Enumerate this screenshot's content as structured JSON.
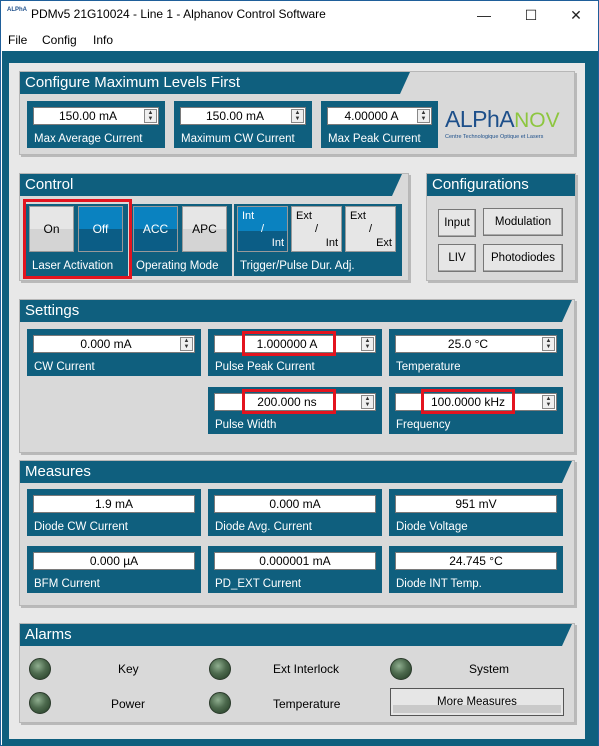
{
  "window": {
    "title": "PDMv5 21G10024 - Line 1 - Alphanov Control Software",
    "app_icon_text": "ALPhA",
    "minimize": "—",
    "maximize": "☐",
    "close": "✕"
  },
  "menu": {
    "items": [
      "File",
      "Config",
      "Info"
    ]
  },
  "configure": {
    "title": "Configure Maximum Levels First",
    "fields": [
      {
        "value": "150.00 mA",
        "label": "Max Average Current"
      },
      {
        "value": "150.00 mA",
        "label": "Maximum CW Current"
      },
      {
        "value": "4.00000 A",
        "label": "Max Peak Current"
      }
    ],
    "logo": {
      "part1": "ALPhA",
      "part2": "NOV",
      "tagline": "Centre Technologique Optique et Lasers",
      "color1": "#1d4f8a",
      "color2": "#8dc63f"
    }
  },
  "control": {
    "title": "Control",
    "laser": {
      "on": "On",
      "off": "Off",
      "label": "Laser Activation",
      "selected": "Off"
    },
    "mode": {
      "acc": "ACC",
      "apc": "APC",
      "label": "Operating Mode",
      "selected": "ACC"
    },
    "trigger": {
      "label": "Trigger/Pulse Dur. Adj.",
      "options": [
        {
          "a": "Int",
          "sep": "/",
          "b": "Int"
        },
        {
          "a": "Ext",
          "sep": "/",
          "b": "Int"
        },
        {
          "a": "Ext",
          "sep": "/",
          "b": "Ext"
        }
      ],
      "selected_index": 0
    }
  },
  "configurations": {
    "title": "Configurations",
    "buttons": [
      "Input",
      "Modulation",
      "LIV",
      "Photodiodes"
    ]
  },
  "settings": {
    "title": "Settings",
    "cw_current": {
      "value": "0.000 mA",
      "label": "CW Current"
    },
    "pulse_peak": {
      "value": "1.000000 A",
      "label": "Pulse Peak Current"
    },
    "temperature": {
      "value": "25.0 °C",
      "label": "Temperature"
    },
    "pulse_width": {
      "value": "200.000 ns",
      "label": "Pulse Width"
    },
    "frequency": {
      "value": "100.0000 kHz",
      "label": "Frequency"
    }
  },
  "measures": {
    "title": "Measures",
    "items": [
      {
        "value": "1.9 mA",
        "label": "Diode CW Current"
      },
      {
        "value": "0.000 mA",
        "label": "Diode Avg. Current"
      },
      {
        "value": "951 mV",
        "label": "Diode Voltage"
      },
      {
        "value": "0.000 µA",
        "label": "BFM Current"
      },
      {
        "value": "0.000001 mA",
        "label": "PD_EXT Current"
      },
      {
        "value": "24.745 °C",
        "label": "Diode INT Temp."
      }
    ]
  },
  "alarms": {
    "title": "Alarms",
    "items": [
      "Key",
      "Ext Interlock",
      "System",
      "Power",
      "Temperature"
    ],
    "more_button": "More Measures"
  },
  "colors": {
    "accent": "#0f5f7e",
    "highlight": "#e3141f",
    "active_button": "#0a82c0"
  }
}
